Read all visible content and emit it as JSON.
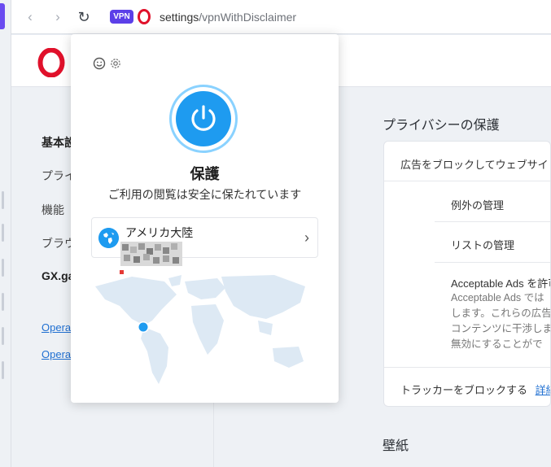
{
  "browser": {
    "vpn_badge": "VPN",
    "url_host": "settings",
    "url_path": "/vpnWithDisclaimer"
  },
  "sidebar": {
    "items": [
      {
        "label": "基本設"
      },
      {
        "label": "プライ"
      },
      {
        "label": "機能"
      },
      {
        "label": "ブラウ"
      },
      {
        "label": "GX.ga"
      }
    ],
    "links": [
      {
        "label": "Opera"
      },
      {
        "label": "Opera"
      }
    ]
  },
  "main": {
    "privacy_title": "プライバシーの保護",
    "block_ads_label": "広告をブロックしてウェブサイ",
    "manage_exceptions": "例外の管理",
    "manage_lists": "リストの管理",
    "acceptable_ads_title": "Acceptable Ads を許可",
    "acceptable_ads_desc": [
      "Acceptable Ads では",
      "します。これらの広告",
      "コンテンツに干渉しま",
      "無効にすることがで"
    ],
    "block_trackers_label": "トラッカーをブロックする",
    "block_trackers_link": "詳細",
    "wallpaper_title": "壁紙"
  },
  "vpn_popup": {
    "status_title": "保護",
    "status_subtitle": "ご利用の閲覧は安全に保たれています",
    "location_name": "アメリカ大陸",
    "accent_color": "#1e9bf0"
  }
}
